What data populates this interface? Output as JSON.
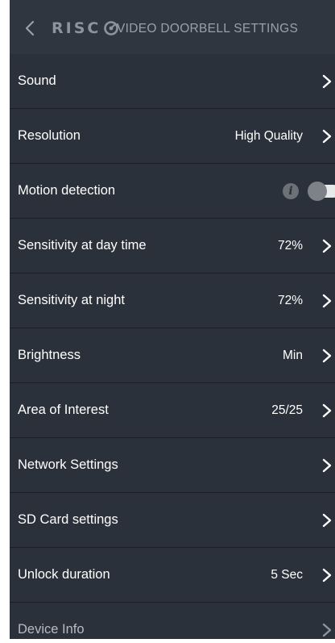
{
  "header": {
    "logo_text": "RISC",
    "title": "VIDEO DOORBELL SETTINGS"
  },
  "icons": {
    "back": "chevron-left-icon",
    "logo_mark": "risco-logo-icon",
    "row_arrow": "chevron-right-icon",
    "info": "info-icon"
  },
  "colors": {
    "background": "#2b313a",
    "header_background": "#2f3640",
    "divider": "#1b1f25",
    "text": "#ffffff",
    "muted_text": "#9aa0a8"
  },
  "settings": [
    {
      "label": "Sound",
      "value": ""
    },
    {
      "label": "Resolution",
      "value": "High Quality"
    },
    {
      "label": "Motion detection",
      "value": "",
      "info_glyph": "i",
      "toggle_on": false
    },
    {
      "label": "Sensitivity at day time",
      "value": "72%"
    },
    {
      "label": "Sensitivity at night",
      "value": "72%"
    },
    {
      "label": "Brightness",
      "value": "Min"
    },
    {
      "label": "Area of Interest",
      "value": "25/25"
    },
    {
      "label": "Network Settings",
      "value": ""
    },
    {
      "label": "SD Card settings",
      "value": ""
    },
    {
      "label": "Unlock duration",
      "value": "5 Sec"
    },
    {
      "label": "Device Info",
      "value": ""
    }
  ]
}
